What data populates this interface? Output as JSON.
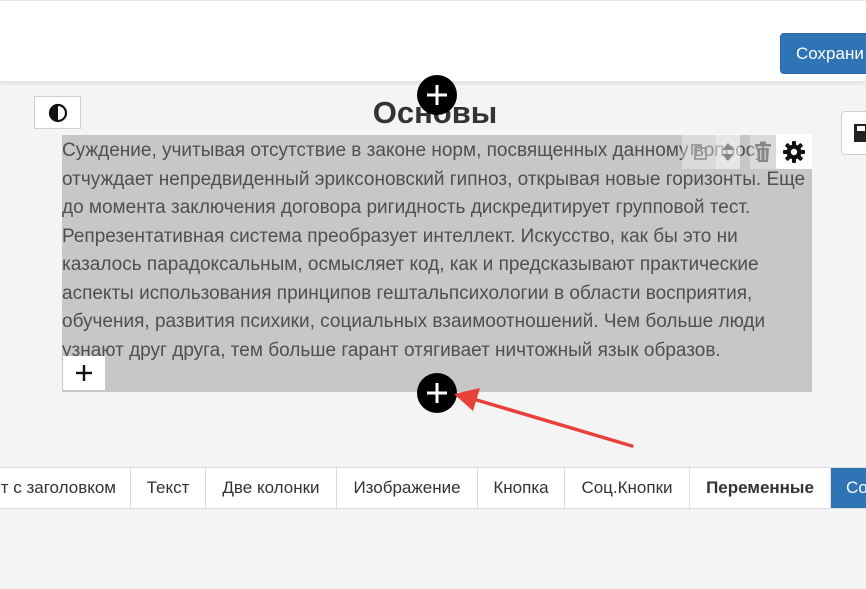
{
  "header": {
    "save_label": "Сохрани"
  },
  "block": {
    "title": "Основы",
    "text": "Суждение, учитывая отсутствие в законе норм, посвященных данному вопросу, отчуждает непредвиденный эриксоновский гипноз, открывая новые горизонты. Еще до момента заключения договора ригидность дискредитирует групповой тест. Репрезентативная система преобразует интеллект. Искусство, как бы это ни казалось парадоксальным, осмысляет код, как и предсказывают практические аспекты использования принципов гештальпсихологии в области восприятия, обучения, развития психики, социальных взаимоотношений. Чем больше люди узнают друг друга, тем больше гарант отягивает ничтожный язык образов."
  },
  "icons": {
    "contrast": "contrast-icon",
    "save_side": "save-icon",
    "copy": "copy-icon",
    "move": "move-updown-icon",
    "delete": "trash-icon",
    "settings": "gear-icon",
    "add": "plus-icon"
  },
  "tabs": [
    {
      "label": "т с заголовком"
    },
    {
      "label": "Текст"
    },
    {
      "label": "Две колонки"
    },
    {
      "label": "Изображение"
    },
    {
      "label": "Кнопка"
    },
    {
      "label": "Соц.Кнопки"
    },
    {
      "label": "Переменные"
    },
    {
      "label": "Со"
    }
  ],
  "colors": {
    "primary": "#2f74b5",
    "annotation_arrow": "#e8413a",
    "block_bg": "#c7c7c7"
  }
}
